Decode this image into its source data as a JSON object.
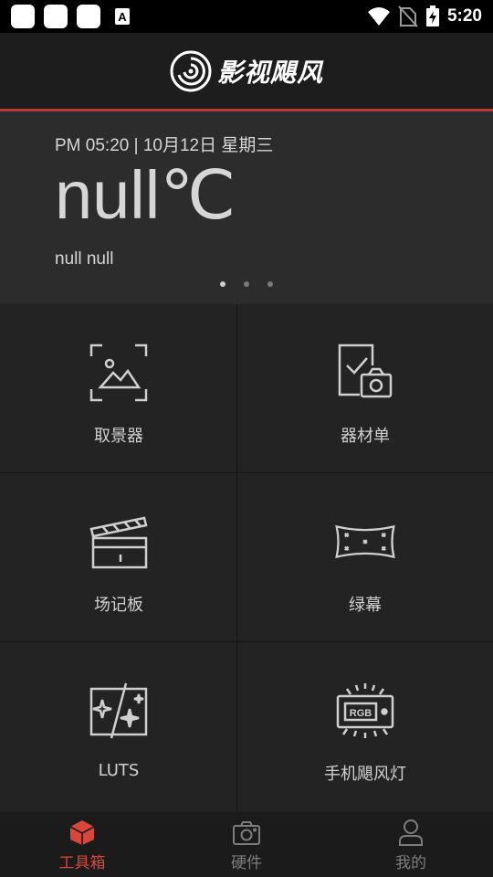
{
  "status_bar": {
    "time": "5:20",
    "icons": [
      "notification-square",
      "notification-square",
      "notification-square",
      "font-a-icon",
      "wifi-icon",
      "no-sim-icon",
      "battery-charging-icon"
    ]
  },
  "header": {
    "logo_text": "影视飓风",
    "accent_color": "#b83a3a"
  },
  "weather": {
    "datetime": "PM 05:20 | 10月12日 星期三",
    "temperature": "null℃",
    "description": "null null",
    "pages": 3,
    "active_page": 0
  },
  "tools": [
    {
      "label": "取景器",
      "icon": "viewfinder-icon"
    },
    {
      "label": "器材单",
      "icon": "equipment-list-icon"
    },
    {
      "label": "场记板",
      "icon": "clapperboard-icon"
    },
    {
      "label": "绿幕",
      "icon": "green-screen-icon"
    },
    {
      "label": "LUTS",
      "icon": "luts-icon"
    },
    {
      "label": "手机飓风灯",
      "icon": "rgb-light-icon"
    }
  ],
  "bottom_nav": {
    "items": [
      {
        "label": "工具箱",
        "icon": "toolbox-cube-icon",
        "active": true
      },
      {
        "label": "硬件",
        "icon": "camera-icon",
        "active": false
      },
      {
        "label": "我的",
        "icon": "person-icon",
        "active": false
      }
    ],
    "active_color": "#d9463b"
  }
}
